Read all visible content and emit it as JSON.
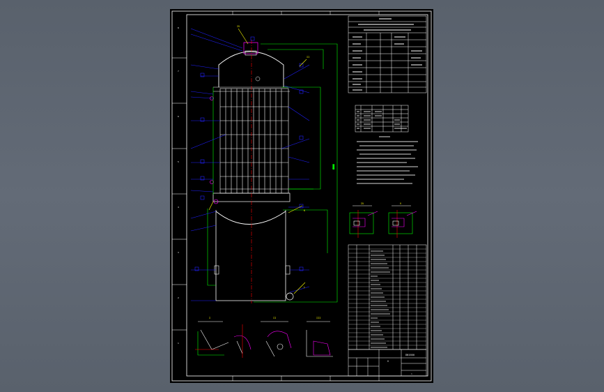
{
  "drawing": {
    "section_labels": [
      "I",
      "II",
      "III"
    ],
    "detail_labels": [
      "IV",
      "V"
    ],
    "title_block": {
      "line1": "DN1600",
      "line2": "Ⅱ",
      "drawing_no": "1"
    }
  },
  "colors": {
    "background": "#5c6470",
    "sheet": "#000000",
    "frame": "#ffffff",
    "vessel": "#ffffff",
    "leader": "#0000ff",
    "dimension": "#00ff00",
    "centerline": "#ff0000",
    "weld": "#ff00ff",
    "callout": "#ffff00"
  }
}
